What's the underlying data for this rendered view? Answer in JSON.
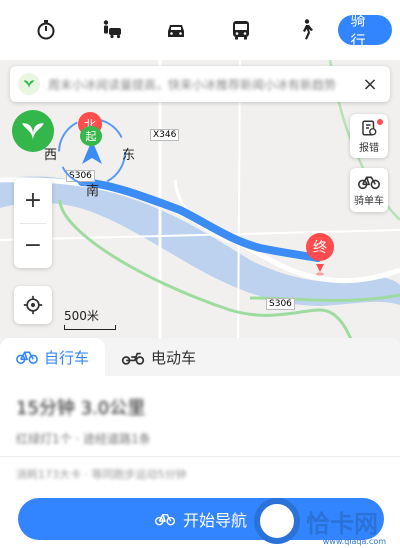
{
  "modes": {
    "items": [
      {
        "name": "timer-icon"
      },
      {
        "name": "taxi-icon"
      },
      {
        "name": "car-icon"
      },
      {
        "name": "bus-icon"
      },
      {
        "name": "walk-icon"
      }
    ],
    "active_label": "骑行"
  },
  "notice": {
    "text": "周末小冰阅读量提高，快来小冰推荐新闻小冰有新趋势",
    "close": "×"
  },
  "compass": {
    "north": "北",
    "start": "起",
    "west": "西",
    "east": "东",
    "south": "南"
  },
  "side": {
    "report_label": "报错",
    "bike_label": "骑单车"
  },
  "zoom": {
    "in": "+",
    "out": "−"
  },
  "map": {
    "scale_label": "500米",
    "end_label": "终",
    "roads": [
      "S306",
      "X346",
      "S306"
    ]
  },
  "panel": {
    "tabs": [
      {
        "label": "自行车"
      },
      {
        "label": "电动车"
      }
    ],
    "route_main": "15分钟  3.0公里",
    "route_sub": "红绿灯1个 · 途经道路1条",
    "route_note": "消耗173大卡 · 等同跑步运动5分钟",
    "start_button": "开始导航"
  },
  "watermark": {
    "text": "恰卡网",
    "url": "www.qiaqa.com"
  },
  "colors": {
    "accent": "#3385ff",
    "route": "#3b8cf5",
    "green": "#33b64a",
    "red": "#ff4d4d"
  }
}
